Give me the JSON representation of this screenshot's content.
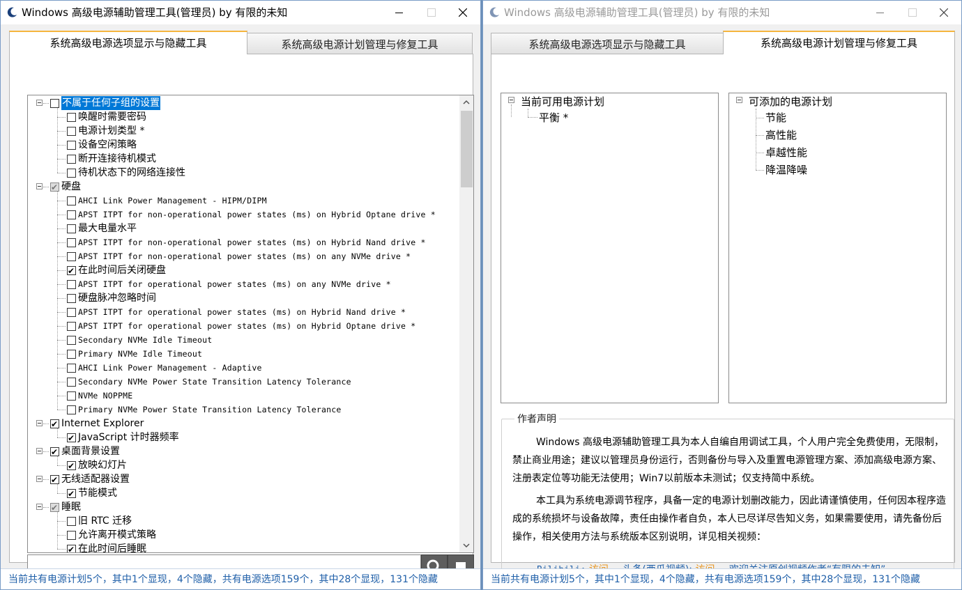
{
  "windows": [
    {
      "title": "Windows 高级电源辅助管理工具(管理员)  by 有限的未知",
      "tabs": [
        "系统高级电源选项显示与隐藏工具",
        "系统高级电源计划管理与修复工具"
      ],
      "active_tab": 0,
      "status": "当前共有电源计划5个，其中1个显现，4个隐藏，共有电源选项159个，其中28个显现，131个隐藏"
    },
    {
      "title": "Windows 高级电源辅助管理工具(管理员)  by 有限的未知",
      "tabs": [
        "系统高级电源选项显示与隐藏工具",
        "系统高级电源计划管理与修复工具"
      ],
      "active_tab": 1,
      "status": "当前共有电源计划5个，其中1个显现，4个隐藏，共有电源选项159个，其中28个显现，131个隐藏"
    }
  ],
  "options_tree": [
    {
      "label": "不属于任何子组的设置",
      "level": 0,
      "checked": false,
      "selected": true,
      "mono": false
    },
    {
      "label": "唤醒时需要密码",
      "level": 1,
      "checked": false,
      "mono": false
    },
    {
      "label": "电源计划类型 *",
      "level": 1,
      "checked": false,
      "mono": false
    },
    {
      "label": "设备空闲策略",
      "level": 1,
      "checked": false,
      "mono": false
    },
    {
      "label": "断开连接待机模式",
      "level": 1,
      "checked": false,
      "mono": false
    },
    {
      "label": "待机状态下的网络连接性",
      "level": 1,
      "checked": false,
      "mono": false
    },
    {
      "label": "硬盘",
      "level": 0,
      "checked": "partial",
      "mono": false
    },
    {
      "label": "AHCI Link Power Management - HIPM/DIPM",
      "level": 1,
      "checked": false,
      "mono": true
    },
    {
      "label": "APST ITPT for non-operational power states (ms) on Hybrid Optane drive *",
      "level": 1,
      "checked": false,
      "mono": true
    },
    {
      "label": "最大电量水平",
      "level": 1,
      "checked": false,
      "mono": false
    },
    {
      "label": "APST ITPT for non-operational power states (ms) on Hybrid Nand drive *",
      "level": 1,
      "checked": false,
      "mono": true
    },
    {
      "label": "APST ITPT for non-operational power states (ms) on any NVMe drive *",
      "level": 1,
      "checked": false,
      "mono": true
    },
    {
      "label": "在此时间后关闭硬盘",
      "level": 1,
      "checked": true,
      "mono": false
    },
    {
      "label": "APST ITPT for operational power states (ms) on any NVMe drive *",
      "level": 1,
      "checked": false,
      "mono": true
    },
    {
      "label": "硬盘脉冲忽略时间",
      "level": 1,
      "checked": false,
      "mono": false
    },
    {
      "label": "APST ITPT for operational power states (ms) on Hybrid Nand drive *",
      "level": 1,
      "checked": false,
      "mono": true
    },
    {
      "label": "APST ITPT for operational power states (ms) on Hybrid Optane drive *",
      "level": 1,
      "checked": false,
      "mono": true
    },
    {
      "label": "Secondary NVMe Idle Timeout",
      "level": 1,
      "checked": false,
      "mono": true
    },
    {
      "label": "Primary NVMe Idle Timeout",
      "level": 1,
      "checked": false,
      "mono": true
    },
    {
      "label": "AHCI Link Power Management - Adaptive",
      "level": 1,
      "checked": false,
      "mono": true
    },
    {
      "label": "Secondary NVMe Power State Transition Latency Tolerance",
      "level": 1,
      "checked": false,
      "mono": true
    },
    {
      "label": "NVMe NOPPME",
      "level": 1,
      "checked": false,
      "mono": true
    },
    {
      "label": "Primary NVMe Power State Transition Latency Tolerance",
      "level": 1,
      "checked": false,
      "mono": true
    },
    {
      "label": "Internet Explorer",
      "level": 0,
      "checked": true,
      "mono": false
    },
    {
      "label": "JavaScript 计时器频率",
      "level": 1,
      "checked": true,
      "mono": false
    },
    {
      "label": "桌面背景设置",
      "level": 0,
      "checked": true,
      "mono": false
    },
    {
      "label": "放映幻灯片",
      "level": 1,
      "checked": true,
      "mono": false
    },
    {
      "label": "无线适配器设置",
      "level": 0,
      "checked": true,
      "mono": false
    },
    {
      "label": "节能模式",
      "level": 1,
      "checked": true,
      "mono": false
    },
    {
      "label": "睡眠",
      "level": 0,
      "checked": "partial",
      "mono": false
    },
    {
      "label": "旧 RTC 迁移",
      "level": 1,
      "checked": false,
      "mono": false
    },
    {
      "label": "允许离开模式策略",
      "level": 1,
      "checked": false,
      "mono": false
    },
    {
      "label": "在此时间后睡眠",
      "level": 1,
      "checked": true,
      "mono": false
    }
  ],
  "search": {
    "value": "",
    "placeholder": ""
  },
  "current_plans": {
    "root": "当前可用电源计划",
    "items": [
      "平衡 *"
    ]
  },
  "addable_plans": {
    "root": "可添加的电源计划",
    "items": [
      "节能",
      "高性能",
      "卓越性能",
      "降温降噪"
    ]
  },
  "author": {
    "title": "作者声明",
    "paragraph1": "Windows 高级电源辅助管理工具为本人自编自用调试工具，个人用户完全免费使用，无限制，禁止商业用途；建议以管理员身份运行，否则备份与导入及重置电源管理方案、添加高级电源方案、注册表定位等功能无法使用；Win7以前版本未测试；仅支持简中系统。",
    "paragraph2": "本工具为系统电源调节程序，具备一定的电源计划删改能力，因此请谨慎使用，任何因本程序造成的系统损坏与设备故障，责任由操作者自负，本人已尽详尽告知义务，如果需要使用，请先备份后操作，相关使用方法与系统版本区别说明，详见相关视频：",
    "bilibili_label": "Bilibili:",
    "bilibili_link": "访问",
    "toutiao_label": "头条(西瓜视频):",
    "toutiao_link": "访问",
    "follow_text": "欢迎关注原创视频作者“有限的未知”。"
  },
  "colors": {
    "accent_tab": "#f6b53e",
    "status_text": "#1f5fa8",
    "selection": "#0078d7",
    "link": "#e8941b"
  },
  "icons": [
    "power-moon-icon",
    "minimize-icon",
    "maximize-icon",
    "close-icon",
    "expander-minus-icon",
    "checkbox-icon",
    "search-icon",
    "stop-icon",
    "scroll-up-icon",
    "scroll-down-icon"
  ]
}
